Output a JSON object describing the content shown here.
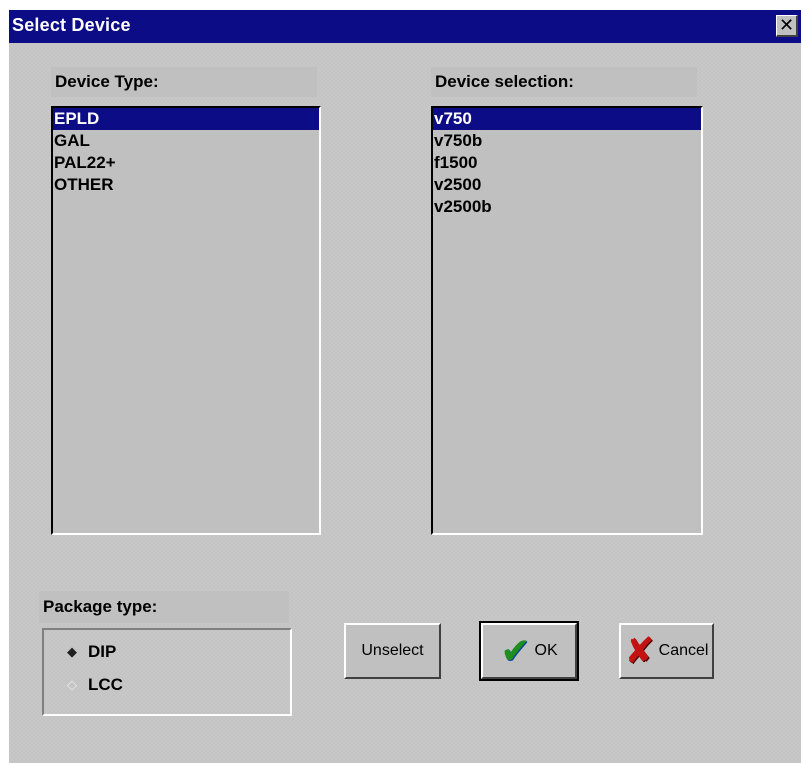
{
  "window": {
    "title": "Select Device",
    "close_symbol": "✕"
  },
  "device_type": {
    "label": "Device Type:",
    "items": [
      "EPLD",
      "GAL",
      "PAL22+",
      "OTHER"
    ],
    "selected": "EPLD"
  },
  "device_selection": {
    "label": "Device selection:",
    "items": [
      "v750",
      "v750b",
      "f1500",
      "v2500",
      "v2500b"
    ],
    "selected": "v750"
  },
  "package_type": {
    "label": "Package type:",
    "options": [
      "DIP",
      "LCC"
    ],
    "selected": "DIP"
  },
  "buttons": {
    "unselect": "Unselect",
    "ok": "OK",
    "cancel": "Cancel"
  },
  "icons": {
    "ok": "check-mark-icon",
    "cancel": "red-x-icon"
  },
  "colors": {
    "titlebar": "#0c0c86",
    "selection": "#0c0c86",
    "ok_check": "#1e8f1e",
    "cancel_x": "#c31212"
  }
}
